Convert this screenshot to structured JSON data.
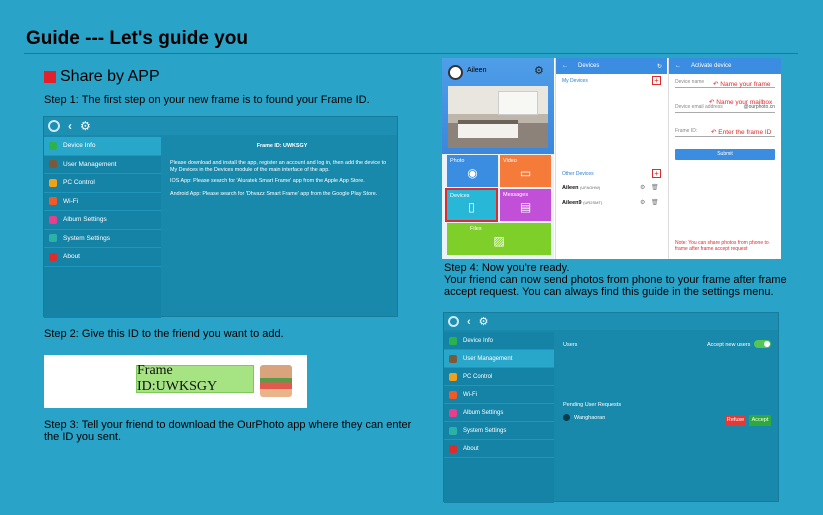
{
  "guide": {
    "title": "Guide --- Let's guide you",
    "section": "Share by APP",
    "step1": "Step 1: The first step on your new frame is to found your Frame ID.",
    "step2": "Step 2: Give this ID to the friend you want to add.",
    "step3": "Step 3: Tell your friend to download the OurPhoto app where they can enter the ID you sent.",
    "step4": "Step 4: Now you're ready.\nYour friend can now send photos from phone to your frame after frame accept request. You can always find this guide in the settings menu."
  },
  "settings1": {
    "menu": [
      "Device Info",
      "User Management",
      "PC Control",
      "Wi-Fi",
      "Album Settings",
      "System Settings",
      "About"
    ],
    "menu_colors": [
      "#2bb24c",
      "#7b5a3a",
      "#f4a11a",
      "#f15a24",
      "#e83e8c",
      "#2bb2a8",
      "#e02b2b"
    ],
    "heading": "Frame ID: UWKSGY",
    "para1": "Please download and install the app, register an account and log in, then add the device to My Devices in the Devices module of the main interface of the app.",
    "para2": "IOS App: Please search for 'Aluratek Smart Frame' app from the Apple App Store.",
    "para3": "Android App: Please search for 'Dhvazz Smart Frame' app from the Google Play Store."
  },
  "frame_id_card": {
    "label": "Frame ID:UWKSGY"
  },
  "phone": {
    "user": "Aileen",
    "tiles": [
      "Photo",
      "Video",
      "Devices",
      "Messages",
      "Files"
    ],
    "devices_title": "Devices",
    "my_devices": "My Devices",
    "other_devices": "Other Devices",
    "device_rows": [
      {
        "name": "Aileen",
        "id": "(UFAGHW)"
      },
      {
        "name": "Aileen9",
        "id": "(UR2SMT)"
      }
    ],
    "activate_title": "Activate device",
    "fields": [
      "Device name",
      "Device email address",
      "Frame ID:"
    ],
    "email_suffix": "@ourphoto.cn",
    "notes": [
      "Name your frame",
      "Name your mailbox",
      "Enter the frame ID"
    ],
    "submit": "Submit",
    "bottom_note": "Note: You can share photos from phone to frame after frame accept request"
  },
  "settings2": {
    "menu": [
      "Device Info",
      "User Management",
      "PC Control",
      "Wi-Fi",
      "Album Settings",
      "System Settings",
      "About"
    ],
    "users_label": "Users",
    "accept_label": "Accept new users",
    "pending_label": "Pending User Requests",
    "pending_user": "Wanghaoran",
    "refuse": "Refuse",
    "accept": "Accept"
  }
}
